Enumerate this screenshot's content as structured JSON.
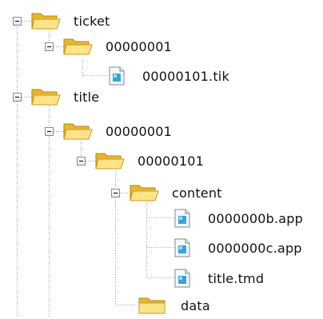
{
  "tree": {
    "items": [
      {
        "label": "ticket",
        "icon": "folder-open-icon",
        "expanded": true
      },
      {
        "label": "00000001",
        "icon": "folder-open-icon",
        "expanded": true
      },
      {
        "label": "00000101.tik",
        "icon": "file-icon"
      },
      {
        "label": "title",
        "icon": "folder-open-icon",
        "expanded": true
      },
      {
        "label": "00000001",
        "icon": "folder-open-icon",
        "expanded": true
      },
      {
        "label": "00000101",
        "icon": "folder-open-icon",
        "expanded": true
      },
      {
        "label": "content",
        "icon": "folder-open-icon",
        "expanded": true
      },
      {
        "label": "0000000b.app",
        "icon": "file-icon"
      },
      {
        "label": "0000000c.app",
        "icon": "file-icon"
      },
      {
        "label": "title.tmd",
        "icon": "file-icon"
      },
      {
        "label": "data",
        "icon": "folder-icon"
      }
    ]
  },
  "colors": {
    "folder_back": "#e8b732",
    "folder_front": "#ffe38a",
    "tree_line": "#9a9a9a",
    "file_accent": "#3aa3d9"
  }
}
